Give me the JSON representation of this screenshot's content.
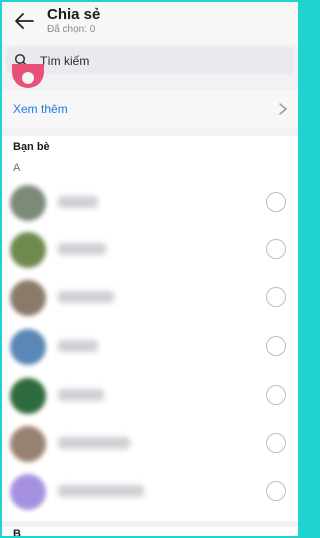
{
  "header": {
    "title": "Chia sẻ",
    "subtitle": "Đã chọn: 0"
  },
  "search": {
    "placeholder": "Tìm kiếm"
  },
  "see_more": {
    "label": "Xem thêm"
  },
  "friends": {
    "section_title": "Bạn bè",
    "groups": [
      {
        "letter": "A",
        "rows": [
          {
            "avatar_color": "#7d8a7a",
            "name_width": 40
          },
          {
            "avatar_color": "#6f8a4f",
            "name_width": 48
          },
          {
            "avatar_color": "#8a7a6a",
            "name_width": 56
          },
          {
            "avatar_color": "#5b87b7",
            "name_width": 40
          },
          {
            "avatar_color": "#2f6b3d",
            "name_width": 46
          },
          {
            "avatar_color": "#9a8272",
            "name_width": 72
          },
          {
            "avatar_color": "#a691e0",
            "name_width": 86
          }
        ]
      },
      {
        "letter": "B",
        "rows": []
      }
    ]
  },
  "colors": {
    "accent": "#1c7ce0",
    "frame_border": "#1fd3cf",
    "partial_avatar": "#e8507a"
  }
}
